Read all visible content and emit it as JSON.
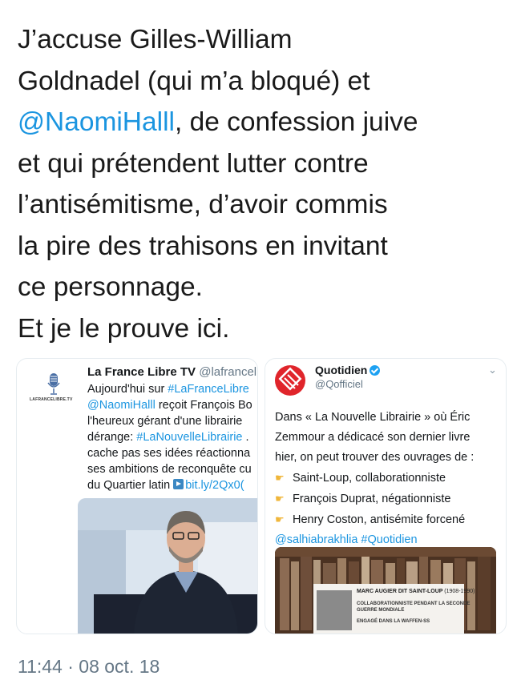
{
  "tweet": {
    "lines": [
      {
        "text": "J’accuse Gilles-William"
      },
      {
        "text": "Goldnadel (qui m’a bloqué) et"
      },
      {
        "mention": "@NaomiHalll",
        "text": ", de confession juive"
      },
      {
        "text": "et qui prétendent lutter contre"
      },
      {
        "text": "l’antisémitisme, d’avoir commis"
      },
      {
        "text": "la pire des trahisons en invitant"
      },
      {
        "text": "ce personnage."
      },
      {
        "text": "Et je le prouve ici."
      }
    ],
    "timestamp": "11:44 · 08 oct. 18"
  },
  "left_tweet": {
    "name": "La France Libre TV",
    "handle": "@lafranceli",
    "logo_text": "LAFRANCELIBRE.TV",
    "body": {
      "l1_text": "Aujourd'hui sur ",
      "l1_hashtag": "#LaFranceLibre",
      "l2_mention": "@NaomiHalll",
      "l2_text": " reçoit François Bo",
      "l3_text": "l'heureux gérant d'une librairie",
      "l4_text": "dérange: ",
      "l4_hashtag": "#LaNouvelleLibrairie",
      "l4_tail": " .",
      "l5_text": "cache pas ses idées réactionna",
      "l6_text": "ses ambitions de reconquête cu",
      "l7_text": "du Quartier latin ",
      "l7_link": "bit.ly/2Qx0("
    }
  },
  "right_tweet": {
    "name": "Quotidien",
    "handle": "@Qofficiel",
    "chevron": "⌄",
    "lines": {
      "l1": "Dans « La Nouvelle Librairie » où Éric",
      "l2": "Zemmour a dédicacé son dernier livre",
      "l3": "hier, on peut trouver des ouvrages de :",
      "l4": "Saint-Loup, collaborationniste",
      "l5": "François Duprat, négationniste",
      "l6": "Henry Coston, antisémite forcené"
    },
    "mention": "@salhiabrakhlia",
    "hashtag": "#Quotidien",
    "card": {
      "title": "MARC AUGIER DIT SAINT-LOUP",
      "years": "(1908-1990)",
      "line1": "COLLABORATIONNISTE PENDANT LA SECONDE",
      "line2": "GUERRE MONDIALE",
      "line3": "ENGAGÉ DANS LA WAFFEN-SS"
    }
  },
  "colors": {
    "link": "#1b95e0",
    "quotidien_red": "#e0252b",
    "muted": "#657786"
  }
}
